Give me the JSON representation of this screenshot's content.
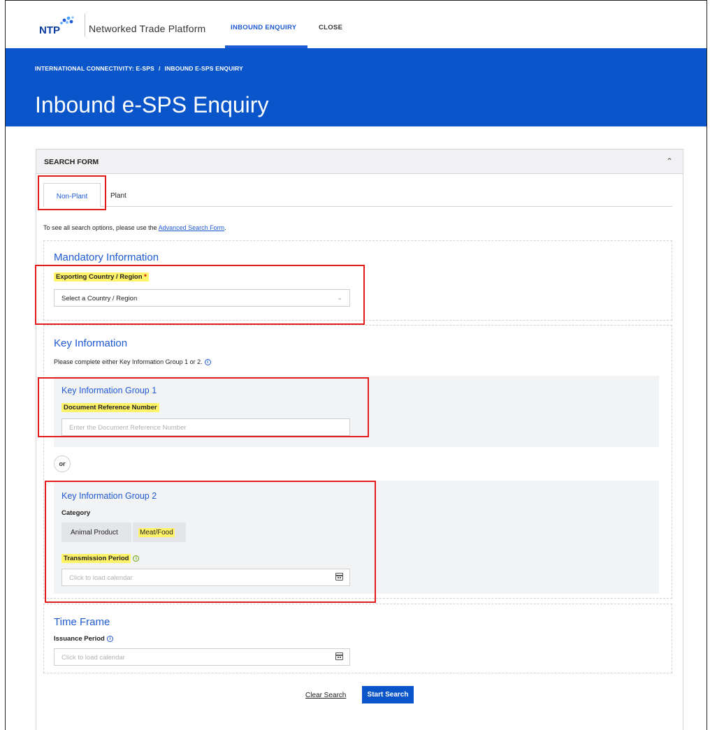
{
  "header": {
    "logo_text": "NTP",
    "brand": "Networked Trade Platform",
    "nav": [
      {
        "label": "INBOUND ENQUIRY",
        "active": true
      },
      {
        "label": "CLOSE",
        "active": false
      }
    ]
  },
  "banner": {
    "breadcrumb": [
      "INTERNATIONAL CONNECTIVITY: E-SPS",
      "INBOUND E-SPS ENQUIRY"
    ],
    "breadcrumb_sep": "/",
    "title": "Inbound e-SPS Enquiry"
  },
  "panel": {
    "title": "SEARCH FORM",
    "tabs": [
      "Non-Plant",
      "Plant"
    ],
    "hint_prefix": "To see all search options, please use the ",
    "hint_link": "Advanced Search Form",
    "hint_suffix": "."
  },
  "mandatory": {
    "title": "Mandatory Information",
    "country_label": "Exporting Country / Region",
    "required_mark": "*",
    "country_value": "Select a Country / Region"
  },
  "key_info": {
    "title": "Key Information",
    "note": "Please complete either Key Information Group 1 or 2.",
    "group1": {
      "title": "Key Information Group 1",
      "doc_ref_label": "Document Reference Number",
      "doc_ref_placeholder": "Enter the Document Reference Number"
    },
    "or_label": "or",
    "group2": {
      "title": "Key Information Group 2",
      "category_label": "Category",
      "categories": [
        "Animal Product",
        "Meat/Food"
      ],
      "transmission_label": "Transmission Period",
      "transmission_placeholder": "Click to load calendar"
    }
  },
  "time_frame": {
    "title": "Time Frame",
    "issuance_label": "Issuance Period",
    "issuance_placeholder": "Click to load calendar"
  },
  "actions": {
    "clear": "Clear Search",
    "start": "Start Search"
  },
  "colors": {
    "brand_blue": "#0a55c9",
    "accent": "#1e5ad4",
    "highlight": "#fff36a",
    "annotation_red": "#e31b1b"
  }
}
